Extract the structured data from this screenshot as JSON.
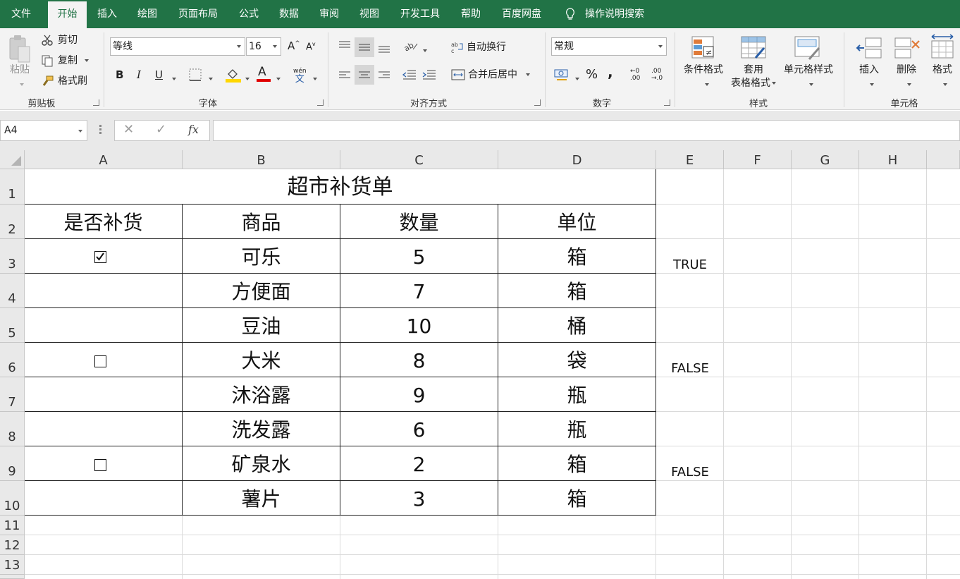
{
  "menu": {
    "tabs": [
      "文件",
      "开始",
      "插入",
      "绘图",
      "页面布局",
      "公式",
      "数据",
      "审阅",
      "视图",
      "开发工具",
      "帮助",
      "百度网盘"
    ],
    "active_tab": "开始",
    "tell_me": "操作说明搜索"
  },
  "ribbon": {
    "clipboard": {
      "label": "剪贴板",
      "paste": "粘贴",
      "cut": "剪切",
      "copy": "复制",
      "format_painter": "格式刷"
    },
    "font": {
      "label": "字体",
      "font_name": "等线",
      "font_size": "16",
      "bold": "B",
      "italic": "I",
      "underline": "U",
      "grow": "A",
      "shrink": "A",
      "phonetic_top": "wén",
      "phonetic_bottom": "文",
      "font_color_letter": "A"
    },
    "alignment": {
      "label": "对齐方式",
      "wrap_text": "自动换行",
      "merge_center": "合并后居中"
    },
    "number": {
      "label": "数字",
      "format": "常规",
      "percent": "%",
      "comma": ",",
      "inc_decimal_top": "←0",
      "inc_decimal_bottom": ".00",
      "dec_decimal_top": ".00",
      "dec_decimal_bottom": "→.0"
    },
    "styles": {
      "label": "样式",
      "conditional_formatting": "条件格式",
      "format_as_table_line1": "套用",
      "format_as_table_line2": "表格格式",
      "cell_styles": "单元格样式"
    },
    "cells": {
      "label": "单元格",
      "insert": "插入",
      "delete": "删除",
      "format": "格式"
    }
  },
  "formula_bar": {
    "name_box": "A4",
    "cancel": "✕",
    "enter": "✓",
    "fx": "fx",
    "formula": ""
  },
  "sheet": {
    "columns": [
      "A",
      "B",
      "C",
      "D",
      "E",
      "F",
      "G",
      "H"
    ],
    "rows": [
      "1",
      "2",
      "3",
      "4",
      "5",
      "6",
      "7",
      "8",
      "9",
      "10",
      "11",
      "12",
      "13"
    ],
    "title": "超市补货单",
    "headers": [
      "是否补货",
      "商品",
      "数量",
      "单位"
    ],
    "items": [
      {
        "product": "可乐",
        "qty": "5",
        "unit": "箱"
      },
      {
        "product": "方便面",
        "qty": "7",
        "unit": "箱"
      },
      {
        "product": "豆油",
        "qty": "10",
        "unit": "桶"
      },
      {
        "product": "大米",
        "qty": "8",
        "unit": "袋"
      },
      {
        "product": "沐浴露",
        "qty": "9",
        "unit": "瓶"
      },
      {
        "product": "洗发露",
        "qty": "6",
        "unit": "瓶"
      },
      {
        "product": "矿泉水",
        "qty": "2",
        "unit": "箱"
      },
      {
        "product": "薯片",
        "qty": "3",
        "unit": "箱"
      }
    ],
    "checkboxes": [
      {
        "row": "3",
        "checked": true,
        "linked_value": "TRUE"
      },
      {
        "row": "6",
        "checked": false,
        "linked_value": "FALSE"
      },
      {
        "row": "9",
        "checked": false,
        "linked_value": "FALSE"
      }
    ]
  },
  "colors": {
    "brand": "#217346",
    "font_color_bar": "#e00000",
    "fill_color_bar": "#ffd700"
  }
}
